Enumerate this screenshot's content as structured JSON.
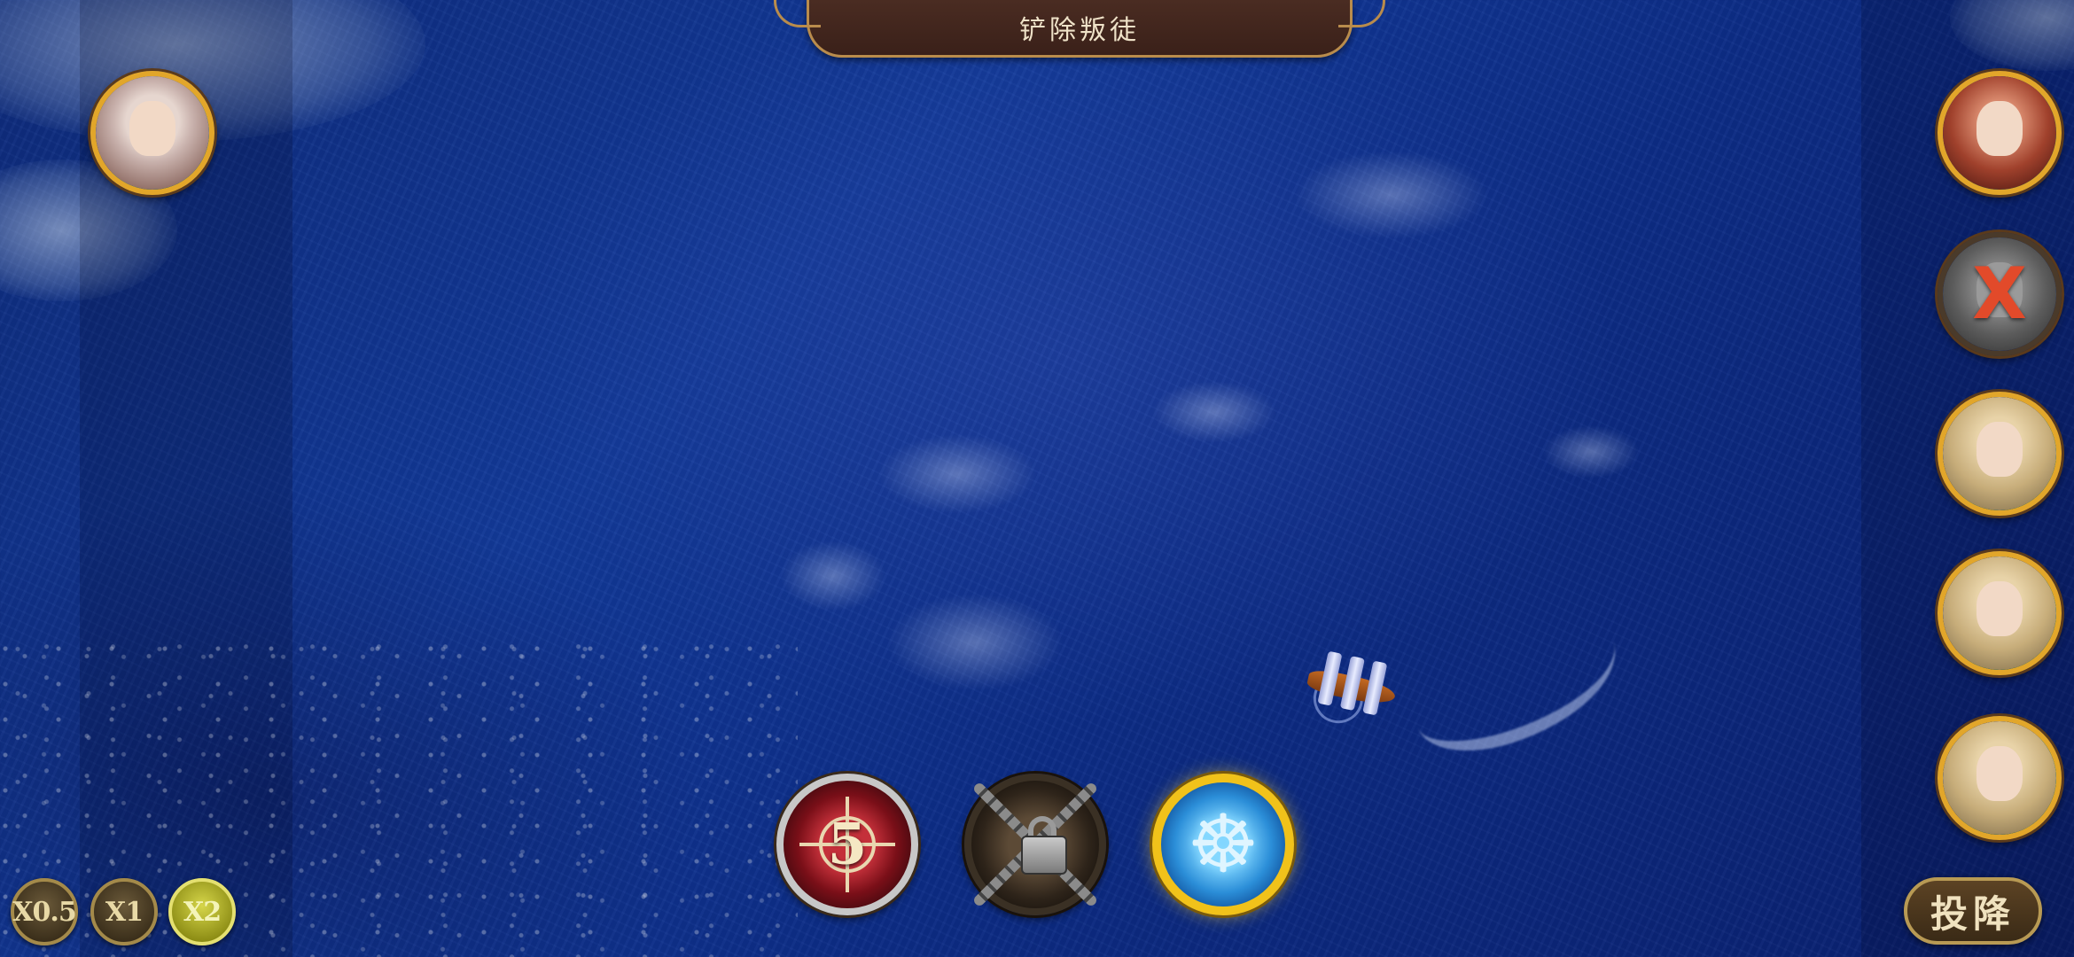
{
  "title": {
    "text": "铲除叛徒"
  },
  "skills": {
    "target_count": "5",
    "helm_icon": "ship-wheel-icon",
    "locked_icon": "padlock-chains-icon",
    "target_icon": "crosshair-icon"
  },
  "speed": {
    "options": [
      "X0.5",
      "X1",
      "X2"
    ],
    "active": "X2"
  },
  "surrender": {
    "label": "投降"
  },
  "crew": {
    "player": [
      {
        "name": "white-haired-woman",
        "status": "alive"
      }
    ],
    "enemy": [
      {
        "name": "red-bearded-captain",
        "status": "alive"
      },
      {
        "name": "grey-officer",
        "status": "defeated",
        "mark": "X"
      },
      {
        "name": "blond-officer",
        "status": "alive"
      },
      {
        "name": "blond-officer",
        "status": "alive"
      },
      {
        "name": "blond-officer",
        "status": "alive"
      }
    ]
  },
  "colors": {
    "ocean": "#123a9a",
    "frame_gold": "#e2a62a",
    "hp_green": "#3ec24a",
    "defeated_red": "#e24a2a",
    "helm_gold": "#f1c21a"
  }
}
